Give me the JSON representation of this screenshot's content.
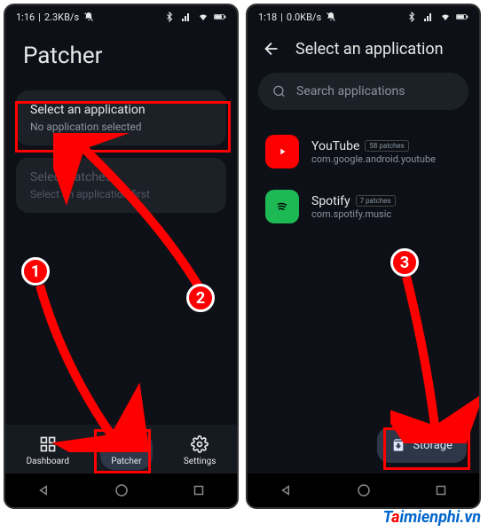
{
  "left": {
    "status": {
      "time": "1:16",
      "speed": "2.3KB/s"
    },
    "title": "Patcher",
    "card1": {
      "title": "Select an application",
      "subtitle": "No application selected"
    },
    "card2": {
      "title": "Select patches",
      "subtitle": "Select an application first"
    },
    "nav": {
      "dashboard": "Dashboard",
      "patcher": "Patcher",
      "settings": "Settings"
    }
  },
  "right": {
    "status": {
      "time": "1:18",
      "speed": "0.0KB/s"
    },
    "title": "Select an application",
    "search": {
      "placeholder": "Search applications"
    },
    "apps": [
      {
        "name": "YouTube",
        "badge": "58 patches",
        "package": "com.google.android.youtube"
      },
      {
        "name": "Spotify",
        "badge": "7 patches",
        "package": "com.spotify.music"
      }
    ],
    "fab": "Storage"
  },
  "badges": {
    "n1": "1",
    "n2": "2",
    "n3": "3"
  },
  "watermark": {
    "t": "T",
    "a": "a",
    "rest": "imienphi",
    "ext": ".vn"
  }
}
